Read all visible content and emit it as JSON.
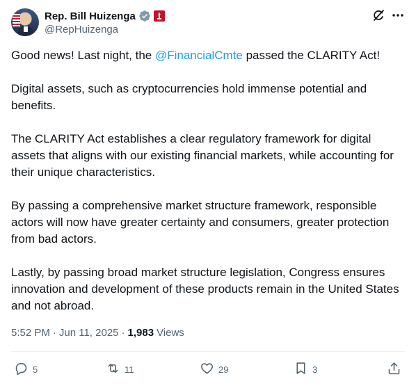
{
  "tweet": {
    "display_name": "Rep. Bill Huizenga",
    "handle": "@RepHuizenga",
    "intro_before": "Good news! Last night, the ",
    "intro_mention": "@FinancialCmte",
    "intro_after": " passed the CLARITY Act!",
    "paragraphs": [
      "Digital assets, such as cryptocurrencies hold immense potential and benefits.",
      "The CLARITY Act establishes a clear regulatory framework for digital assets that aligns with our existing financial markets, while accounting for their unique characteristics.",
      "By passing a comprehensive market structure framework, responsible actors will now have greater certainty and consumers, greater protection from bad actors.",
      "Lastly, by passing broad market structure legislation, Congress ensures innovation and development of these products remain in the United States and not abroad."
    ],
    "time": "5:52 PM",
    "date": "Jun 11, 2025",
    "separator": "·",
    "views_count": "1,983",
    "views_label": "Views"
  },
  "actions": {
    "replies": "5",
    "reposts": "11",
    "likes": "29",
    "bookmarks": "3"
  },
  "icons": {
    "verified": "verified-badge-icon",
    "government": "government-badge-icon",
    "grok": "grok-icon",
    "more": "more-icon",
    "reply": "reply-icon",
    "repost": "repost-icon",
    "like": "heart-icon",
    "bookmark": "bookmark-icon",
    "share": "share-icon"
  },
  "colors": {
    "text": "#0f1419",
    "secondary": "#536471",
    "link": "#1d9bf0",
    "verified_badge": "#829aab",
    "gov_badge": "#c8102e"
  }
}
